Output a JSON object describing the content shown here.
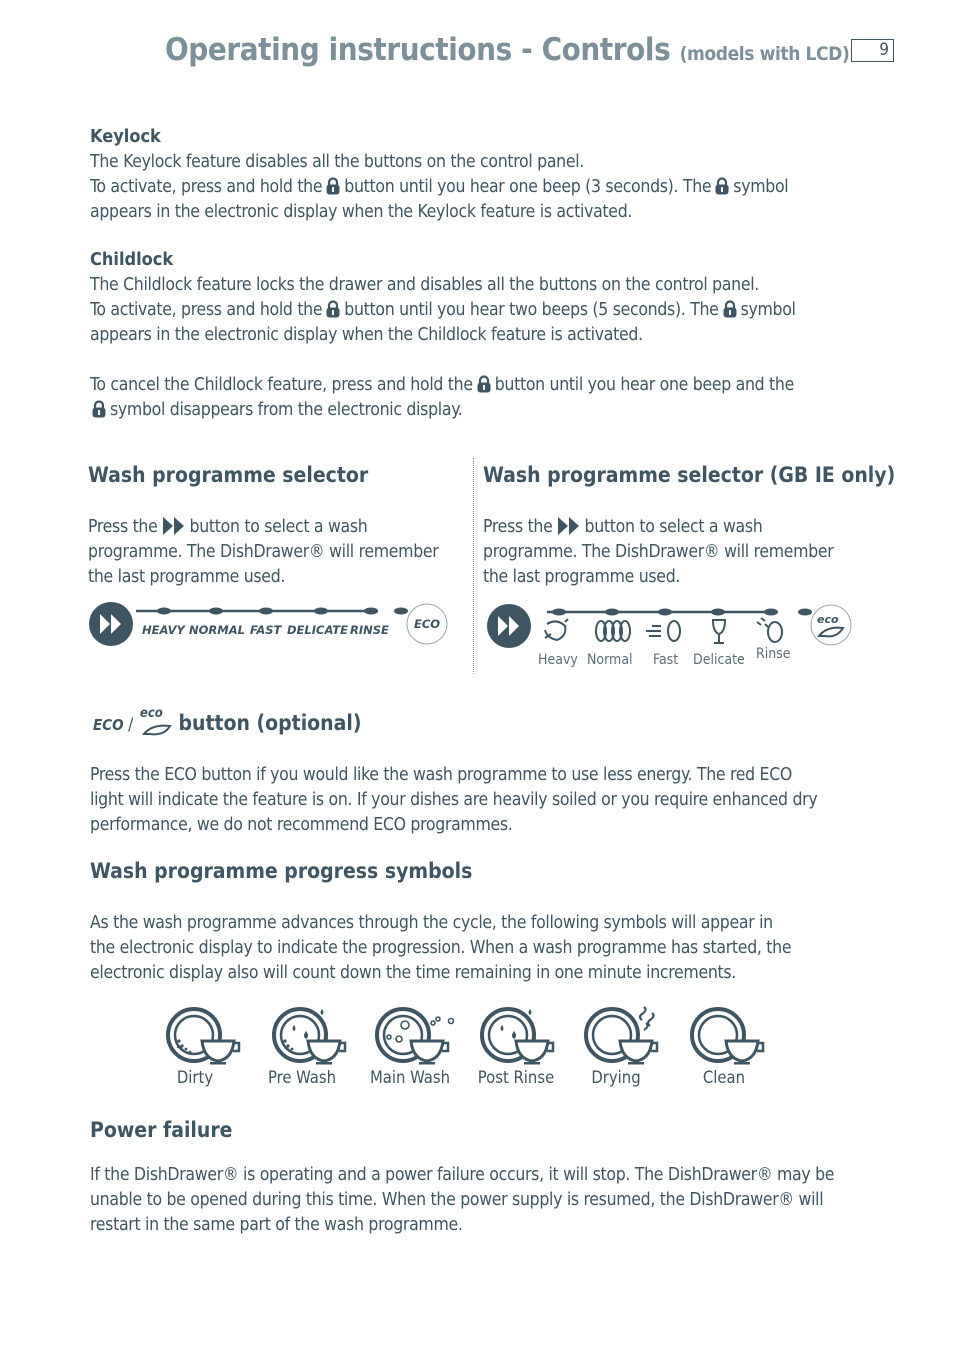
{
  "header": {
    "title": "Operating instructions - Controls",
    "subtitle": "(models with LCD)",
    "page_number": "9"
  },
  "keylock": {
    "heading": "Keylock",
    "line1": "The Keylock feature disables all the buttons on the control panel.",
    "line2a": "To activate, press and hold the",
    "line2b": "button until you hear one beep (3 seconds).  The",
    "line2c": "symbol",
    "line3": "appears in the electronic display when the Keylock feature is activated."
  },
  "childlock": {
    "heading": "Childlock",
    "line1": "The Childlock feature locks the drawer and disables all the buttons on the control panel.",
    "line2a": "To activate, press and hold the",
    "line2b": "button until you hear two beeps (5 seconds).  The",
    "line2c": "symbol",
    "line3": "appears in the electronic display when the Childlock feature is activated.",
    "cancel1a": "To cancel the Childlock feature, press and hold the",
    "cancel1b": "button until you hear one beep and the",
    "cancel2": "symbol disappears from the electronic display."
  },
  "selector_left": {
    "heading": "Wash programme selector",
    "line1a": "Press the",
    "line1b": "button to select a wash",
    "line2": "programme.  The DishDrawer® will remember",
    "line3": "the last programme used.",
    "programs": [
      "HEAVY",
      "NORMAL",
      "FAST",
      "DELICATE",
      "RINSE"
    ],
    "eco_label": "ECO"
  },
  "selector_right": {
    "heading": "Wash programme selector (GB IE only)",
    "line1a": "Press the",
    "line1b": "button to select a wash",
    "line2": "programme.  The DishDrawer® will remember",
    "line3": "the last programme used.",
    "programs": [
      "Heavy",
      "Normal",
      "Fast",
      "Delicate",
      "Rinse"
    ],
    "eco_label": "eco"
  },
  "eco_section": {
    "heading_eco1": "ECO",
    "heading_slash": "/",
    "heading_eco2": "eco",
    "heading": "button (optional)",
    "line1": "Press the ECO button if you would like the wash programme to use less energy.  The red ECO",
    "line2": "light will indicate the feature is on.  If your dishes are heavily soiled or you require enhanced dry",
    "line3": "performance, we do not recommend ECO programmes."
  },
  "progress": {
    "heading": "Wash programme progress symbols",
    "line1": "As the wash programme advances through the cycle, the following symbols will appear in",
    "line2": "the electronic display to indicate the progression. When a wash programme has started, the",
    "line3": "electronic display also will count down the time remaining in one minute increments.",
    "symbols": [
      "Dirty",
      "Pre Wash",
      "Main Wash",
      "Post Rinse",
      "Drying",
      "Clean"
    ]
  },
  "power": {
    "heading": "Power failure",
    "line1": "If the DishDrawer® is operating and a power failure occurs, it will stop. The DishDrawer® may be",
    "line2": "unable to be opened during this time. When the power supply is resumed, the DishDrawer® will",
    "line3": "restart in the same part of the wash programme."
  },
  "colors": {
    "text": "#3f5561",
    "title": "#7d8f99"
  }
}
